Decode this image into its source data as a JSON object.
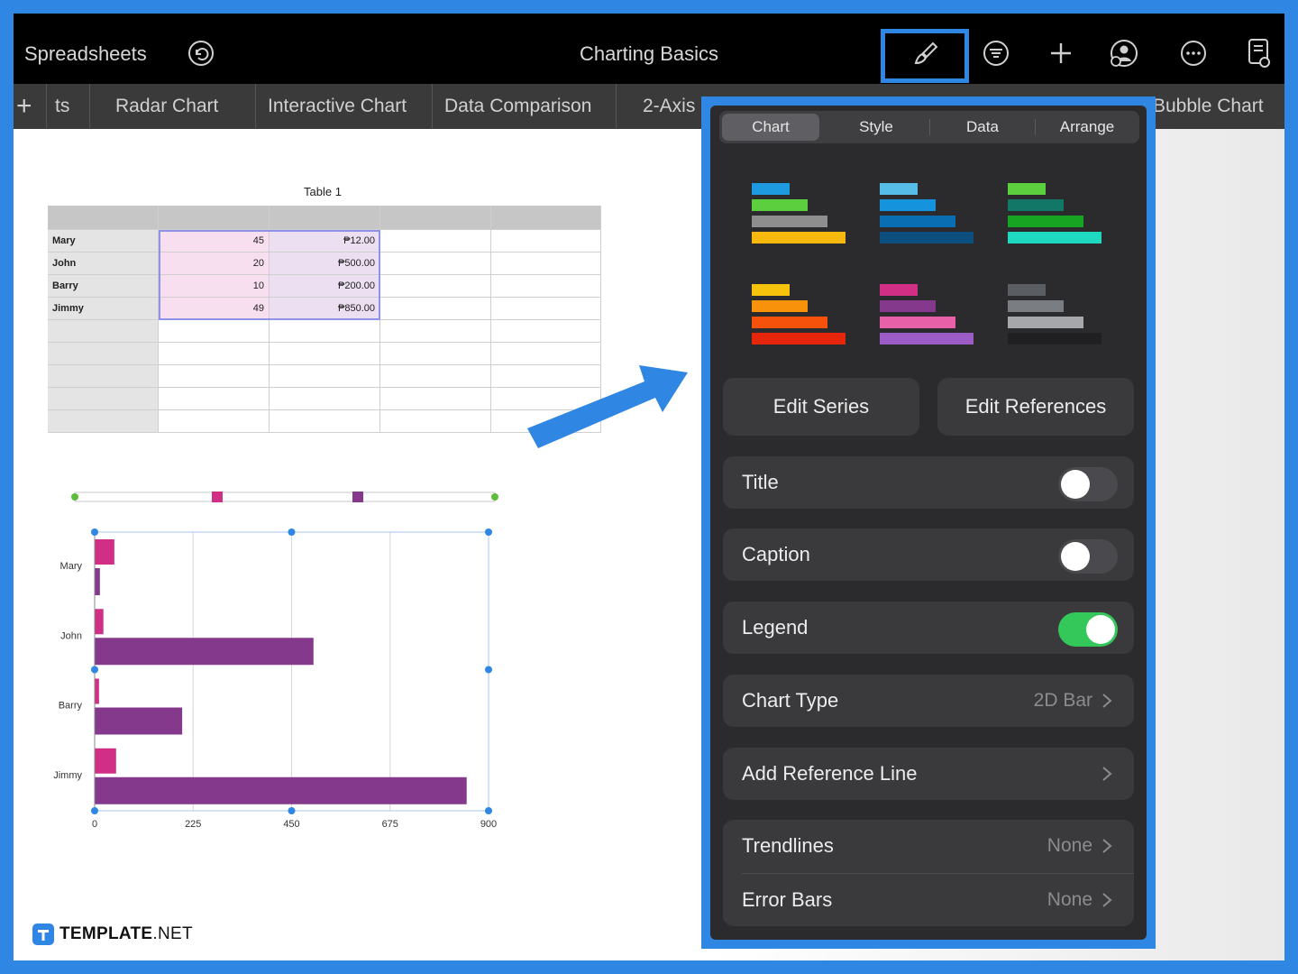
{
  "toolbar": {
    "back_label": "Spreadsheets",
    "title": "Charting Basics",
    "icons": [
      "undo-icon",
      "paintbrush-icon",
      "filter-icon",
      "plus-icon",
      "collaborate-icon",
      "more-icon",
      "reader-icon"
    ]
  },
  "tabs": {
    "add_label": "+",
    "items": [
      "ts",
      "Radar Chart",
      "Interactive Chart",
      "Data Comparison",
      "2-Axis",
      "Bubble Chart"
    ]
  },
  "table": {
    "title": "Table 1",
    "rows": [
      {
        "name": "Mary",
        "a": "45",
        "b": "₱12.00"
      },
      {
        "name": "John",
        "a": "20",
        "b": "₱500.00"
      },
      {
        "name": "Barry",
        "a": "10",
        "b": "₱200.00"
      },
      {
        "name": "Jimmy",
        "a": "49",
        "b": "₱850.00"
      }
    ]
  },
  "chart_data": {
    "type": "bar",
    "orientation": "horizontal",
    "categories": [
      "Mary",
      "John",
      "Barry",
      "Jimmy"
    ],
    "series": [
      {
        "values": [
          45,
          20,
          10,
          49
        ],
        "color": "#d12f86"
      },
      {
        "values": [
          12,
          500,
          200,
          850
        ],
        "color": "#84398c"
      }
    ],
    "xlim": [
      0,
      900
    ],
    "xticks": [
      "0",
      "225",
      "450",
      "675",
      "900"
    ],
    "grid": true
  },
  "panel": {
    "tabs": [
      "Chart",
      "Style",
      "Data",
      "Arrange"
    ],
    "active_tab": "Chart",
    "styles": [
      [
        "#1e9be0",
        "#5bcf3d",
        "#8e8e8e",
        "#f5b80d"
      ],
      [
        "#56bde8",
        "#1593dc",
        "#0a6fb2",
        "#0c4f7f"
      ],
      [
        "#5bcf3d",
        "#137767",
        "#18a423",
        "#1fd8c0"
      ],
      [
        "#f7c20b",
        "#f8920b",
        "#f7520b",
        "#e5260b"
      ],
      [
        "#d12f86",
        "#84398c",
        "#e861a8",
        "#9b5cc5"
      ],
      [
        "#5a5d62",
        "#7a7d82",
        "#a5a7aa",
        "#202022"
      ]
    ],
    "edit_series_label": "Edit Series",
    "edit_references_label": "Edit References",
    "title_label": "Title",
    "title_on": false,
    "caption_label": "Caption",
    "caption_on": false,
    "legend_label": "Legend",
    "legend_on": true,
    "chart_type_label": "Chart Type",
    "chart_type_value": "2D Bar",
    "add_ref_label": "Add Reference Line",
    "trendlines_label": "Trendlines",
    "trendlines_value": "None",
    "error_bars_label": "Error Bars",
    "error_bars_value": "None"
  },
  "colors": {
    "accent_blue": "#2f86e3",
    "toggle_on": "#34c759"
  },
  "branding": {
    "logo_bold": "TEMPLATE",
    "logo_suffix": ".NET"
  }
}
